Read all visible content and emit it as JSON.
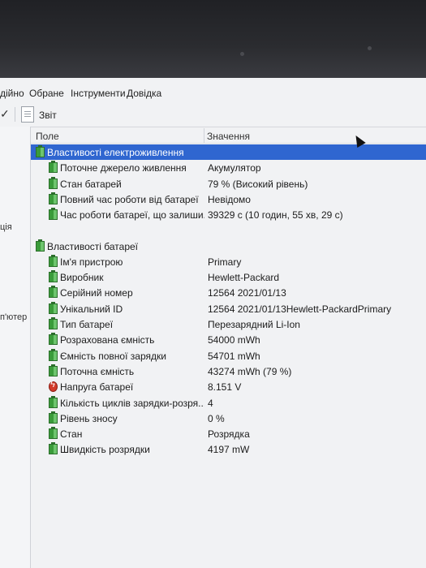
{
  "menu": [
    "дійно",
    "Обране",
    "Інструменти",
    "Довідка"
  ],
  "toolbar": {
    "report_label": "Звіт"
  },
  "left_pane": [
    "ція",
    "п'ютер"
  ],
  "columns": {
    "field": "Поле",
    "value": "Значення"
  },
  "sections": [
    {
      "title": "Властивості електроживлення",
      "selected": true,
      "rows": [
        {
          "field": "Поточне джерело живлення",
          "value": "Акумулятор",
          "icon": "battery-icon"
        },
        {
          "field": "Стан батарей",
          "value": "79 % (Високий рівень)",
          "icon": "battery-icon"
        },
        {
          "field": "Повний час роботи від батареї",
          "value": "Невідомо",
          "icon": "battery-icon"
        },
        {
          "field": "Час роботи батареї, що залиши...",
          "value": "39329 с (10 годин, 55 хв, 29 с)",
          "icon": "battery-icon"
        }
      ]
    },
    {
      "title": "Властивості батареї",
      "selected": false,
      "rows": [
        {
          "field": "Ім'я пристрою",
          "value": "Primary",
          "icon": "battery-icon"
        },
        {
          "field": "Виробник",
          "value": "Hewlett-Packard",
          "icon": "battery-icon"
        },
        {
          "field": "Серійний номер",
          "value": "12564 2021/01/13",
          "icon": "battery-icon"
        },
        {
          "field": "Унікальний ID",
          "value": "12564 2021/01/13Hewlett-PackardPrimary",
          "icon": "battery-icon"
        },
        {
          "field": "Тип батареї",
          "value": "Перезарядний Li-Ion",
          "icon": "battery-icon"
        },
        {
          "field": "Розрахована ємність",
          "value": "54000 mWh",
          "icon": "battery-icon"
        },
        {
          "field": "Ємність повної зарядки",
          "value": "54701 mWh",
          "icon": "battery-icon"
        },
        {
          "field": "Поточна ємність",
          "value": "43274 mWh  (79 %)",
          "icon": "battery-icon"
        },
        {
          "field": "Напруга батареї",
          "value": "8.151 V",
          "icon": "voltage-icon"
        },
        {
          "field": "Кількість циклів зарядки-розря...",
          "value": "4",
          "icon": "battery-icon"
        },
        {
          "field": "Рівень зносу",
          "value": "0 %",
          "icon": "battery-icon"
        },
        {
          "field": "Стан",
          "value": "Розрядка",
          "icon": "battery-icon"
        },
        {
          "field": "Швидкість розрядки",
          "value": "4197 mW",
          "icon": "battery-icon"
        }
      ]
    }
  ]
}
